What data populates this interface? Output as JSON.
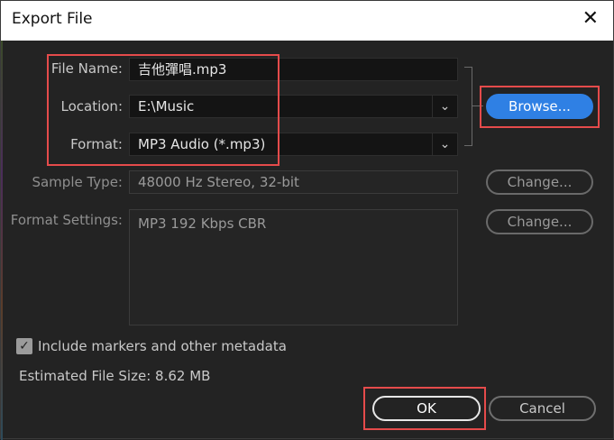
{
  "window": {
    "title": "Export File",
    "close_glyph": "✕"
  },
  "fields": {
    "file_name": {
      "label": "File Name:",
      "value": "吉他彈唱.mp3"
    },
    "location": {
      "label": "Location:",
      "value": "E:\\Music"
    },
    "format": {
      "label": "Format:",
      "value": "MP3 Audio (*.mp3)"
    },
    "sample_type": {
      "label": "Sample Type:",
      "value": "48000 Hz Stereo, 32-bit"
    },
    "format_settings": {
      "label": "Format Settings:",
      "value": "MP3 192 Kbps CBR"
    }
  },
  "buttons": {
    "browse": "Browse...",
    "change_sample": "Change...",
    "change_format": "Change...",
    "ok": "OK",
    "cancel": "Cancel"
  },
  "metadata": {
    "checked": true,
    "label": "Include markers and other metadata"
  },
  "estimated_size": "Estimated File Size: 8.62 MB",
  "icons": {
    "dropdown": "chevron-down-icon",
    "check": "checkmark-icon",
    "close": "close-icon"
  },
  "colors": {
    "accent": "#2f80e4",
    "highlight": "#e54b4b"
  }
}
